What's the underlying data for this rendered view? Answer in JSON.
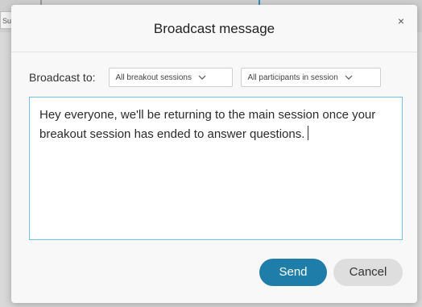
{
  "background": {
    "sliver_text": "Su"
  },
  "dialog": {
    "title": "Broadcast message",
    "close_symbol": "×",
    "broadcast_label": "Broadcast to:",
    "session_select": {
      "selected": "All breakout sessions"
    },
    "participant_select": {
      "selected": "All participants in session"
    },
    "message": {
      "value": "Hey everyone, we'll be returning to the main session once your breakout session has ended to answer questions."
    },
    "send_label": "Send",
    "cancel_label": "Cancel"
  },
  "colors": {
    "accent": "#1f7ea9",
    "focus_border": "#6ec5df",
    "cancel_bg": "#dedede"
  },
  "icons": {
    "close": "close-icon",
    "dropdown": "chevron-down-icon"
  }
}
